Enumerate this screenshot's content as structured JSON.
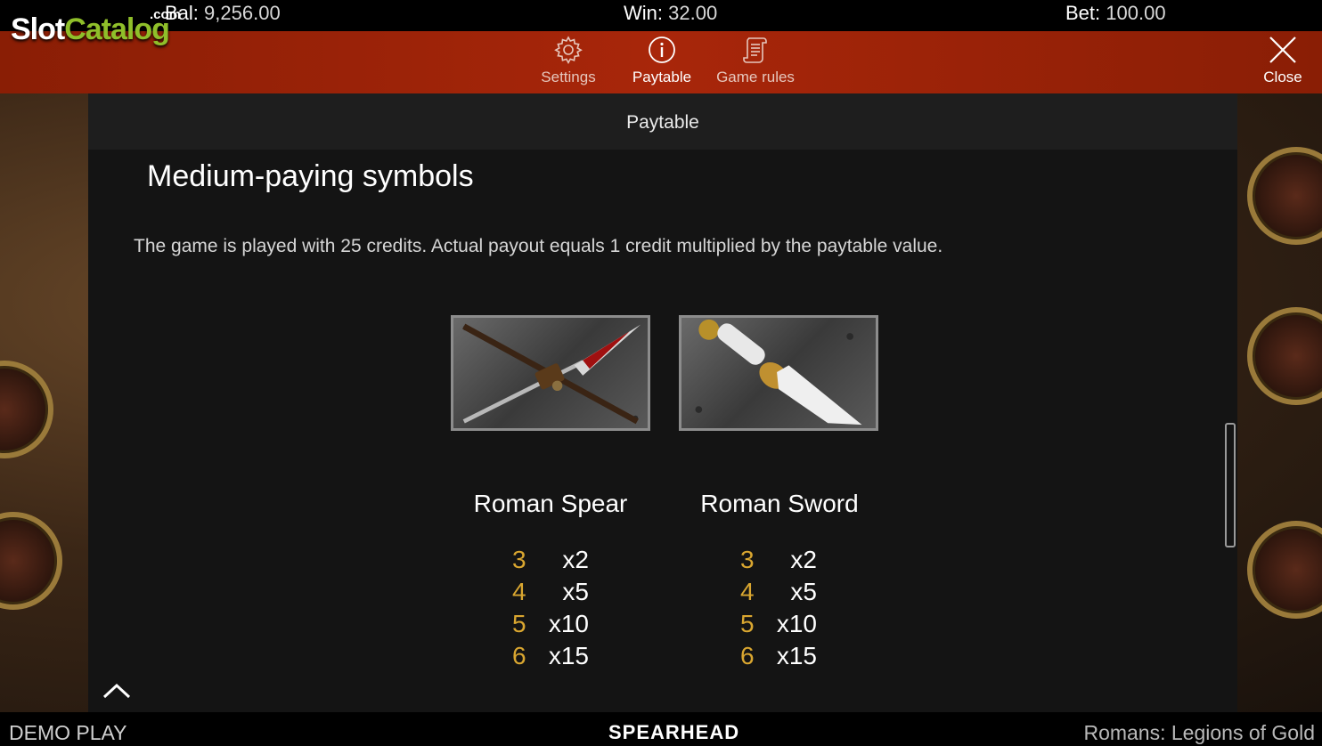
{
  "logo": {
    "part1": "Slot",
    "part2": "Catalog",
    "suffix": ".com"
  },
  "topbar": {
    "balance_label": "Bal:",
    "balance_value": "9,256.00",
    "win_label": "Win:",
    "win_value": "32.00",
    "bet_label": "Bet:",
    "bet_value": "100.00"
  },
  "menu": {
    "settings_label": "Settings",
    "settings_icon": "gear-icon",
    "paytable_label": "Paytable",
    "paytable_icon": "info-icon",
    "rules_label": "Game rules",
    "rules_icon": "scroll-icon",
    "close_label": "Close",
    "close_icon": "close-icon"
  },
  "panel": {
    "header": "Paytable",
    "section_title": "Medium-paying symbols",
    "intro": "The game is played with 25 credits. Actual payout equals 1 credit multiplied by the paytable value.",
    "symbols": [
      {
        "name": "Roman Spear",
        "icon": "spear-icon",
        "pays": [
          {
            "count": "3",
            "mult": "x2"
          },
          {
            "count": "4",
            "mult": "x5"
          },
          {
            "count": "5",
            "mult": "x10"
          },
          {
            "count": "6",
            "mult": "x15"
          }
        ]
      },
      {
        "name": "Roman Sword",
        "icon": "sword-icon",
        "pays": [
          {
            "count": "3",
            "mult": "x2"
          },
          {
            "count": "4",
            "mult": "x5"
          },
          {
            "count": "5",
            "mult": "x10"
          },
          {
            "count": "6",
            "mult": "x15"
          }
        ]
      }
    ]
  },
  "bottombar": {
    "mode": "DEMO PLAY",
    "provider": "SPEARHEAD",
    "game_title": "Romans: Legions of Gold"
  },
  "colors": {
    "menu_bar": "#a8260a",
    "panel_bg": "#141414",
    "count_gold": "#d9a630",
    "logo_green": "#8fbf2a"
  }
}
